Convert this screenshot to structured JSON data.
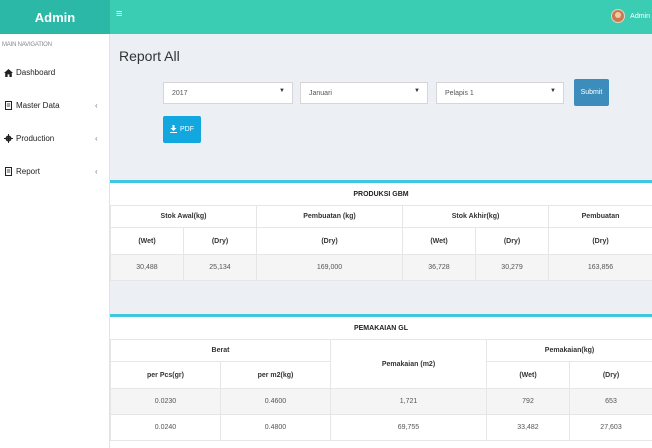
{
  "app": {
    "brand": "Admin",
    "user": "Admin"
  },
  "sidebar": {
    "header": "MAIN NAVIGATION",
    "items": [
      {
        "label": "Dashboard",
        "icon": "dashboard-icon",
        "chevron": false
      },
      {
        "label": "Master Data",
        "icon": "file-icon",
        "chevron": true
      },
      {
        "label": "Production",
        "icon": "gear-icon",
        "chevron": true
      },
      {
        "label": "Report",
        "icon": "file-icon",
        "chevron": true
      }
    ]
  },
  "page": {
    "title": "Report All"
  },
  "filters": {
    "year": "2017",
    "month": "Januari",
    "pelapis": "Pelapis 1",
    "submit_label": "Submit",
    "pdf_label": "PDF"
  },
  "gbm": {
    "title": "PRODUKSI GBM",
    "headers": [
      "Stok Awal(kg)",
      "Pembuatan (kg)",
      "Stok Akhir(kg)",
      "Pembuatan"
    ],
    "subheaders": [
      "(Wet)",
      "(Dry)",
      "(Dry)",
      "(Wet)",
      "(Dry)",
      "(Dry)"
    ],
    "row": [
      "30,488",
      "25,134",
      "169,000",
      "36,728",
      "30,279",
      "163,856"
    ]
  },
  "gl": {
    "title": "PEMAKAIAN GL",
    "headers": {
      "berat": "Berat",
      "pemakaian_m2": "Pemakaian (m2)",
      "pemakaian_kg": "Pemakaian(kg)"
    },
    "subheaders": [
      "per Pcs(gr)",
      "per m2(kg)",
      "(Wet)",
      "(Dry)"
    ],
    "rows": [
      [
        "0.0230",
        "0.4600",
        "1,721",
        "792",
        "653"
      ],
      [
        "0.0240",
        "0.4800",
        "69,755",
        "33,482",
        "27,603"
      ]
    ]
  },
  "colors": {
    "topbar": "#3bcdb4",
    "logo": "#2cb8a6",
    "submit": "#3c8dbc",
    "pdf": "#13a7e0",
    "panel_border": "#3ec7e0"
  }
}
